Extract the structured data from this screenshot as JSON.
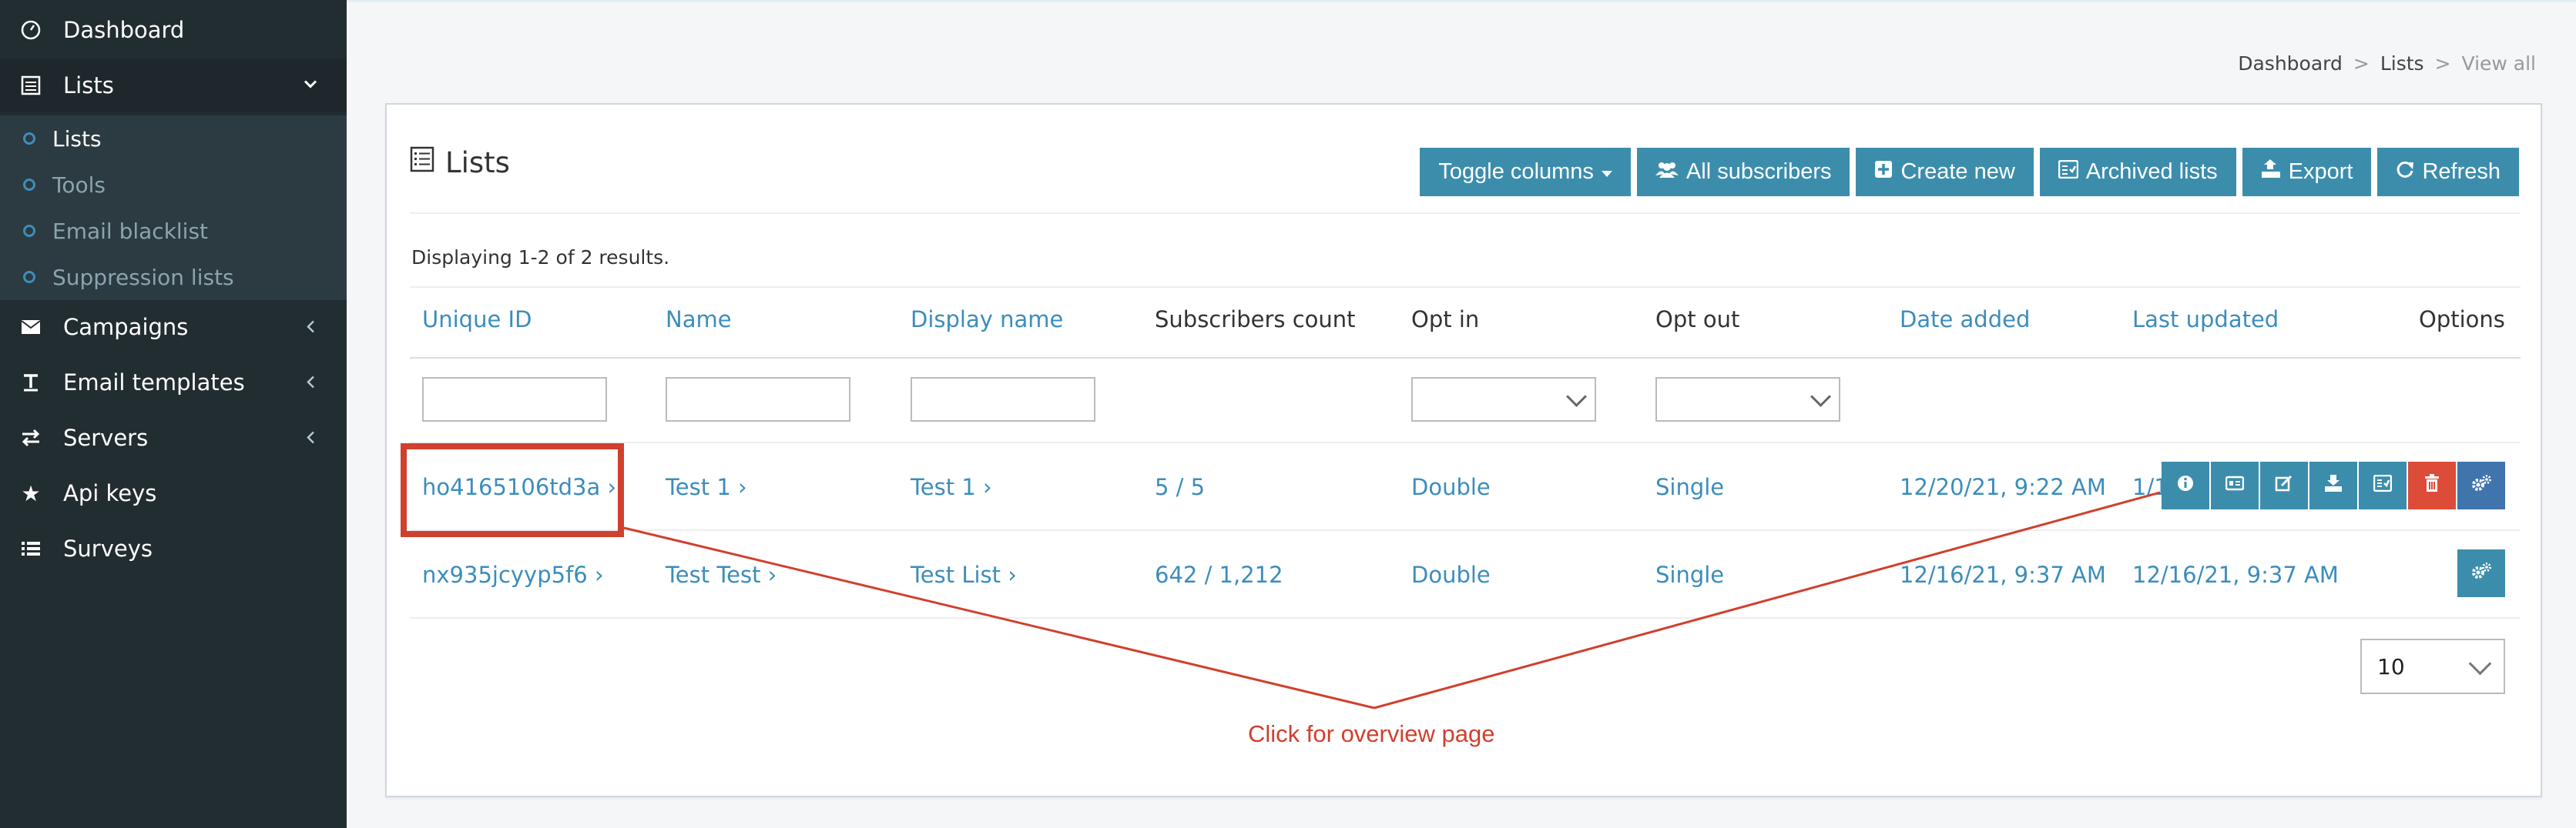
{
  "sidebar": {
    "items": [
      {
        "label": "Dashboard",
        "icon": "dashboard-icon"
      },
      {
        "label": "Lists",
        "icon": "list-icon",
        "expanded": true
      },
      {
        "label": "Campaigns",
        "icon": "envelope-icon"
      },
      {
        "label": "Email templates",
        "icon": "text-icon"
      },
      {
        "label": "Servers",
        "icon": "exchange-icon"
      },
      {
        "label": "Api keys",
        "icon": "star-icon"
      },
      {
        "label": "Surveys",
        "icon": "list-icon"
      }
    ],
    "lists_submenu": [
      {
        "label": "Lists"
      },
      {
        "label": "Tools"
      },
      {
        "label": "Email blacklist"
      },
      {
        "label": "Suppression lists"
      }
    ]
  },
  "breadcrumb": {
    "home": "Dashboard",
    "section": "Lists",
    "current": "View all",
    "separator": ">"
  },
  "card": {
    "title": "Lists",
    "buttons": {
      "toggle_columns": "Toggle columns",
      "all_subscribers": "All subscribers",
      "create_new": "Create new",
      "archived_lists": "Archived lists",
      "export": "Export",
      "refresh": "Refresh"
    },
    "summary": "Displaying 1-2 of 2 results."
  },
  "table": {
    "columns": {
      "unique_id": "Unique ID",
      "name": "Name",
      "display_name": "Display name",
      "subscribers_count": "Subscribers count",
      "opt_in": "Opt in",
      "opt_out": "Opt out",
      "date_added": "Date added",
      "last_updated": "Last updated",
      "options": "Options"
    },
    "rows": [
      {
        "unique_id": "ho4165106td3a ›",
        "name": "Test 1 ›",
        "display_name": "Test 1 ›",
        "subscribers": "5 / 5",
        "opt_in": "Double",
        "opt_out": "Single",
        "date_added": "12/20/21, 9:22 AM",
        "last_updated": "1/10"
      },
      {
        "unique_id": "nx935jcyyp5f6 ›",
        "name": "Test Test ›",
        "display_name": "Test List ›",
        "subscribers": "642 / 1,212",
        "opt_in": "Double",
        "opt_out": "Single",
        "date_added": "12/16/21, 9:37 AM",
        "last_updated": "12/16/21, 9:37 AM"
      }
    ],
    "page_size": "10"
  },
  "annotation": {
    "text": "Click for overview page",
    "color": "#d0402e"
  },
  "colors": {
    "sidebar_bg": "#222d32",
    "accent": "#3c8dac",
    "link": "#3c8dbc",
    "danger": "#dd4b39"
  }
}
